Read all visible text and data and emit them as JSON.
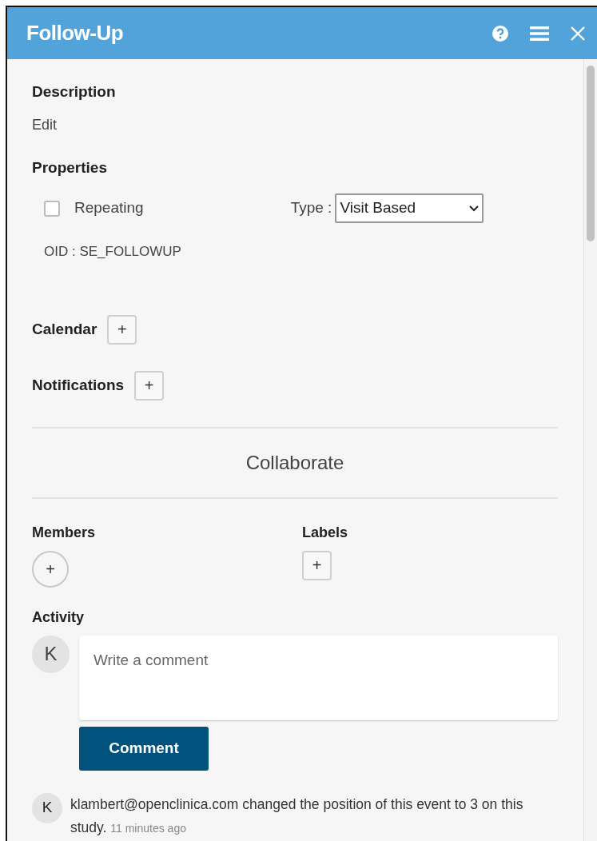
{
  "window": {
    "title": "Follow-Up"
  },
  "description": {
    "heading": "Description",
    "link": "Edit"
  },
  "properties": {
    "heading": "Properties",
    "repeating": {
      "label": "Repeating",
      "checked": false
    },
    "type": {
      "label": "Type :",
      "value": "Visit Based"
    },
    "oid": "OID : SE_FOLLOWUP"
  },
  "calendar": {
    "heading": "Calendar",
    "button": "+"
  },
  "notifications": {
    "heading": "Notifications",
    "button": "+"
  },
  "collaborate": {
    "heading": "Collaborate",
    "members": {
      "heading": "Members",
      "button": "+"
    },
    "labels": {
      "heading": "Labels",
      "button": "+"
    }
  },
  "activity": {
    "heading": "Activity",
    "avatar": "K",
    "comment_field": {
      "placeholder": "Write a comment"
    },
    "comment_button": "Comment",
    "entries": [
      {
        "avatar": "K",
        "text": "klambert@openclinica.com changed the position of this event to 3 on this study.",
        "time": "11 minutes ago"
      }
    ]
  }
}
